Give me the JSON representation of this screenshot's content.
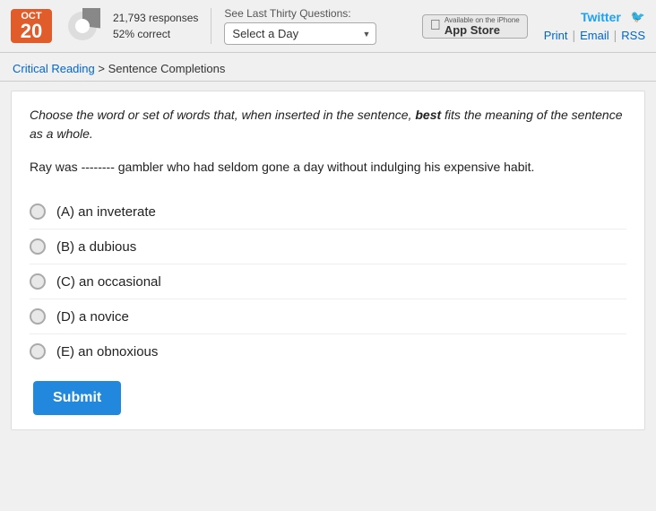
{
  "header": {
    "date": {
      "month": "Oct",
      "day": "20"
    },
    "stats": {
      "responses": "21,793 responses",
      "correct": "52% correct"
    },
    "see_last_label": "See Last Thirty Questions:",
    "select_placeholder": "Select a Day",
    "twitter_label": "Twitter",
    "print_label": "Print",
    "email_label": "Email",
    "rss_label": "RSS",
    "app_store": {
      "available": "Available on the iPhone",
      "label": "App Store"
    }
  },
  "breadcrumb": {
    "parent": "Critical Reading",
    "separator": " > ",
    "current": "Sentence Completions"
  },
  "instructions": {
    "text_before": "Choose the word or set of words that, when inserted in the sentence, ",
    "bold_word": "best",
    "text_after": " fits the meaning of the sentence as a whole."
  },
  "question": {
    "text": "Ray was -------- gambler who had seldom gone a day without indulging his expensive habit."
  },
  "options": [
    {
      "id": "A",
      "label": "(A) an inveterate"
    },
    {
      "id": "B",
      "label": "(B) a dubious"
    },
    {
      "id": "C",
      "label": "(C) an occasional"
    },
    {
      "id": "D",
      "label": "(D) a novice"
    },
    {
      "id": "E",
      "label": "(E) an obnoxious"
    }
  ],
  "submit_label": "Submit",
  "pie": {
    "correct_pct": 52
  }
}
